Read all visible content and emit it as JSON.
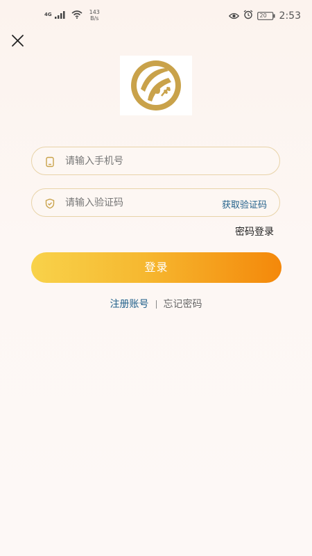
{
  "status_bar": {
    "network": "4G",
    "speed_value": "143",
    "speed_unit": "B/s",
    "battery": "20",
    "time": "2:53",
    "icons": [
      "signal-icon",
      "wifi-icon",
      "eye-icon",
      "alarm-icon",
      "battery-icon"
    ]
  },
  "login": {
    "phone_placeholder": "请输入手机号",
    "code_placeholder": "请输入验证码",
    "get_code_label": "获取验证码",
    "password_login_label": "密码登录",
    "login_button_label": "登录",
    "register_label": "注册账号",
    "forgot_label": "忘记密码"
  },
  "colors": {
    "accent_blue": "#1f5f8a",
    "gradient_start": "#f8d24a",
    "gradient_end": "#f4880a",
    "logo_gold": "#c9a24a",
    "field_border": "#e8d3a8"
  }
}
